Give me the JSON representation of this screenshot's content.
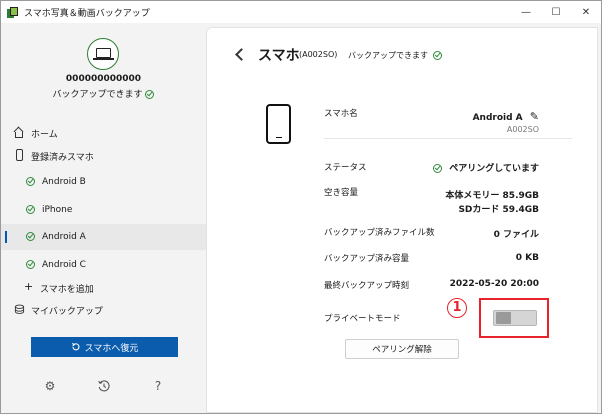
{
  "window": {
    "title": "スマホ写真＆動画バックアップ",
    "controls": {
      "minimize": "—",
      "maximize": "☐",
      "close": "✕"
    }
  },
  "sidebar": {
    "device_id": "000000000000",
    "backup_status": "バックアップできます",
    "nav": {
      "home": "ホーム",
      "registered": "登録済みスマホ",
      "phones": [
        "Android B",
        "iPhone",
        "Android A",
        "Android C"
      ],
      "selected_phone": "Android A",
      "add_phone": "スマホを追加",
      "my_backup": "マイバックアップ"
    },
    "restore_button": "スマホへ復元",
    "bottom_icons": [
      "settings-icon",
      "history-icon",
      "help-icon"
    ]
  },
  "main": {
    "title": "スマホ",
    "model": "(A002SO)",
    "status": "バックアップできます",
    "details": {
      "name_label": "スマホ名",
      "name_value": "Android A",
      "name_sub": "A002SO",
      "status_label": "ステータス",
      "status_value": "ペアリングしています",
      "free_label": "空き容量",
      "free_memory": "本体メモリー 85.9GB",
      "free_sd": "SDカード 59.4GB",
      "files_label": "バックアップ済みファイル数",
      "files_value": "0 ファイル",
      "size_label": "バックアップ済み容量",
      "size_value": "0 KB",
      "last_label": "最終バックアップ時刻",
      "last_value": "2022-05-20 20:00",
      "private_label": "プライベートモード",
      "private_mode_on": false
    },
    "unpair_button": "ペアリング解除",
    "callout_number": "1"
  },
  "colors": {
    "accent": "#0b5cad",
    "success": "#2e8b3a",
    "highlight": "#e8232b"
  }
}
